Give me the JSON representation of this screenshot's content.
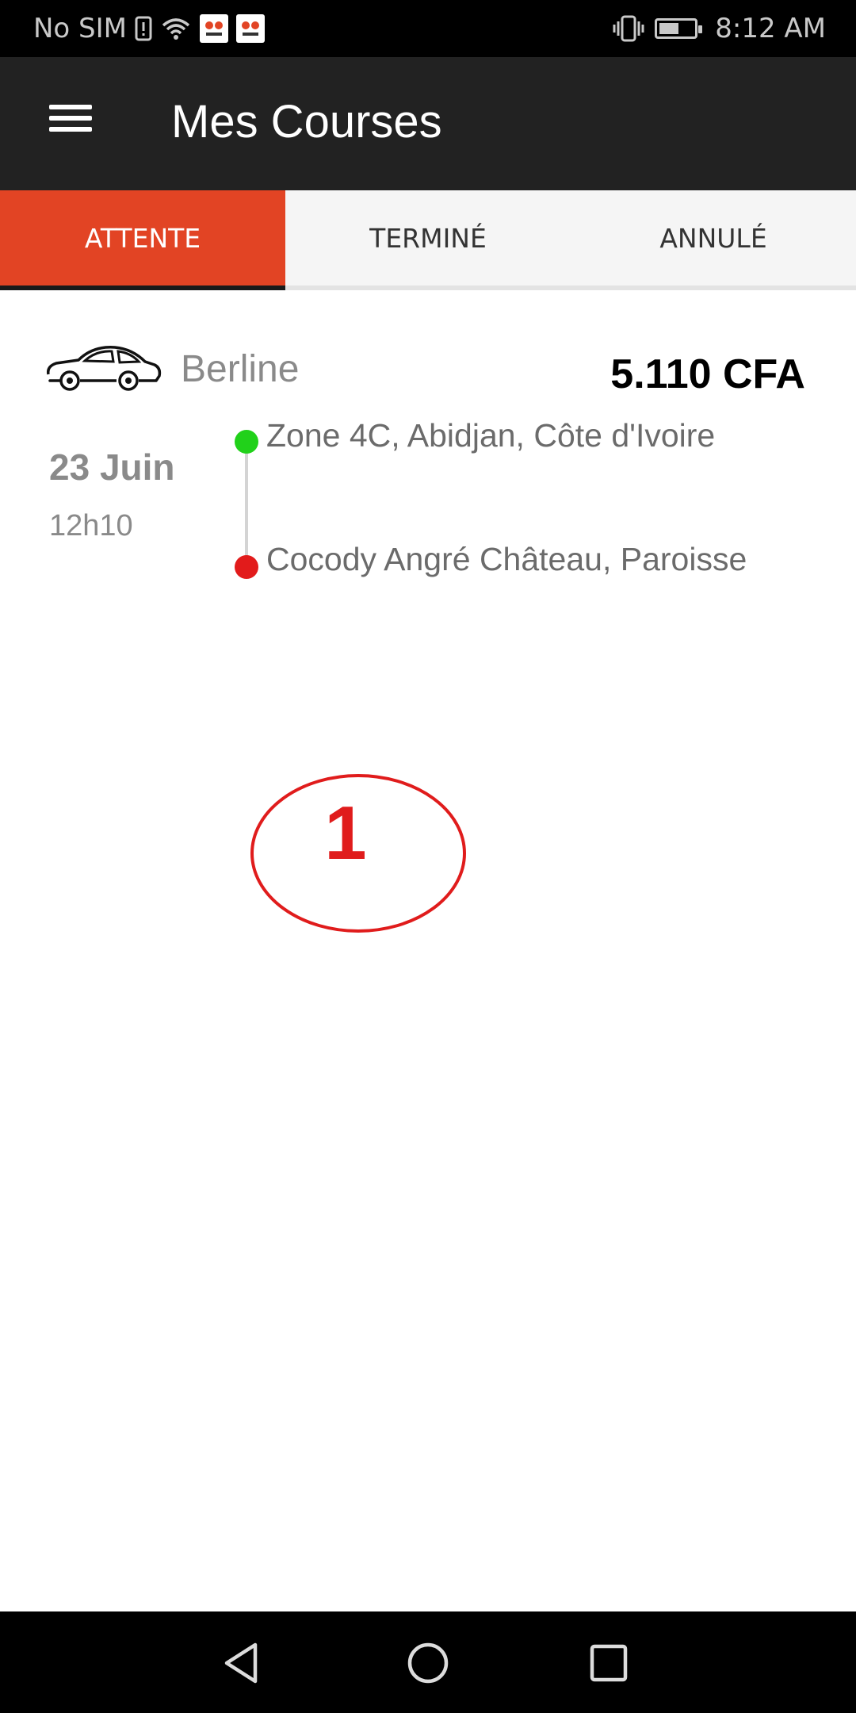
{
  "status_bar": {
    "carrier": "No SIM",
    "time": "8:12 AM",
    "icons": [
      "sim-alert-icon",
      "wifi-icon",
      "taxi-app-icon",
      "taxi-app-icon",
      "vibrate-icon",
      "battery-icon"
    ]
  },
  "app_bar": {
    "title": "Mes Courses",
    "menu_icon": "hamburger-menu-icon"
  },
  "tabs": [
    {
      "label": "ATTENTE",
      "active": true
    },
    {
      "label": "TERMINÉ",
      "active": false
    },
    {
      "label": "ANNULÉ",
      "active": false
    }
  ],
  "ride": {
    "vehicle_type": "Berline",
    "vehicle_icon": "car-icon",
    "price": "5.110 CFA",
    "date": "23 Juin",
    "time": "12h10",
    "from": "Zone 4C, Abidjan, Côte d'Ivoire",
    "to": "Cocody Angré Château, Paroisse"
  },
  "annotation": {
    "label": "1",
    "color": "#e01c1c"
  },
  "colors": {
    "accent": "#e24424",
    "app_bar": "#222222",
    "start_dot": "#21d11a",
    "end_dot": "#e21b1b"
  },
  "nav_bar": {
    "buttons": [
      "back-icon",
      "home-icon",
      "recent-apps-icon"
    ]
  }
}
